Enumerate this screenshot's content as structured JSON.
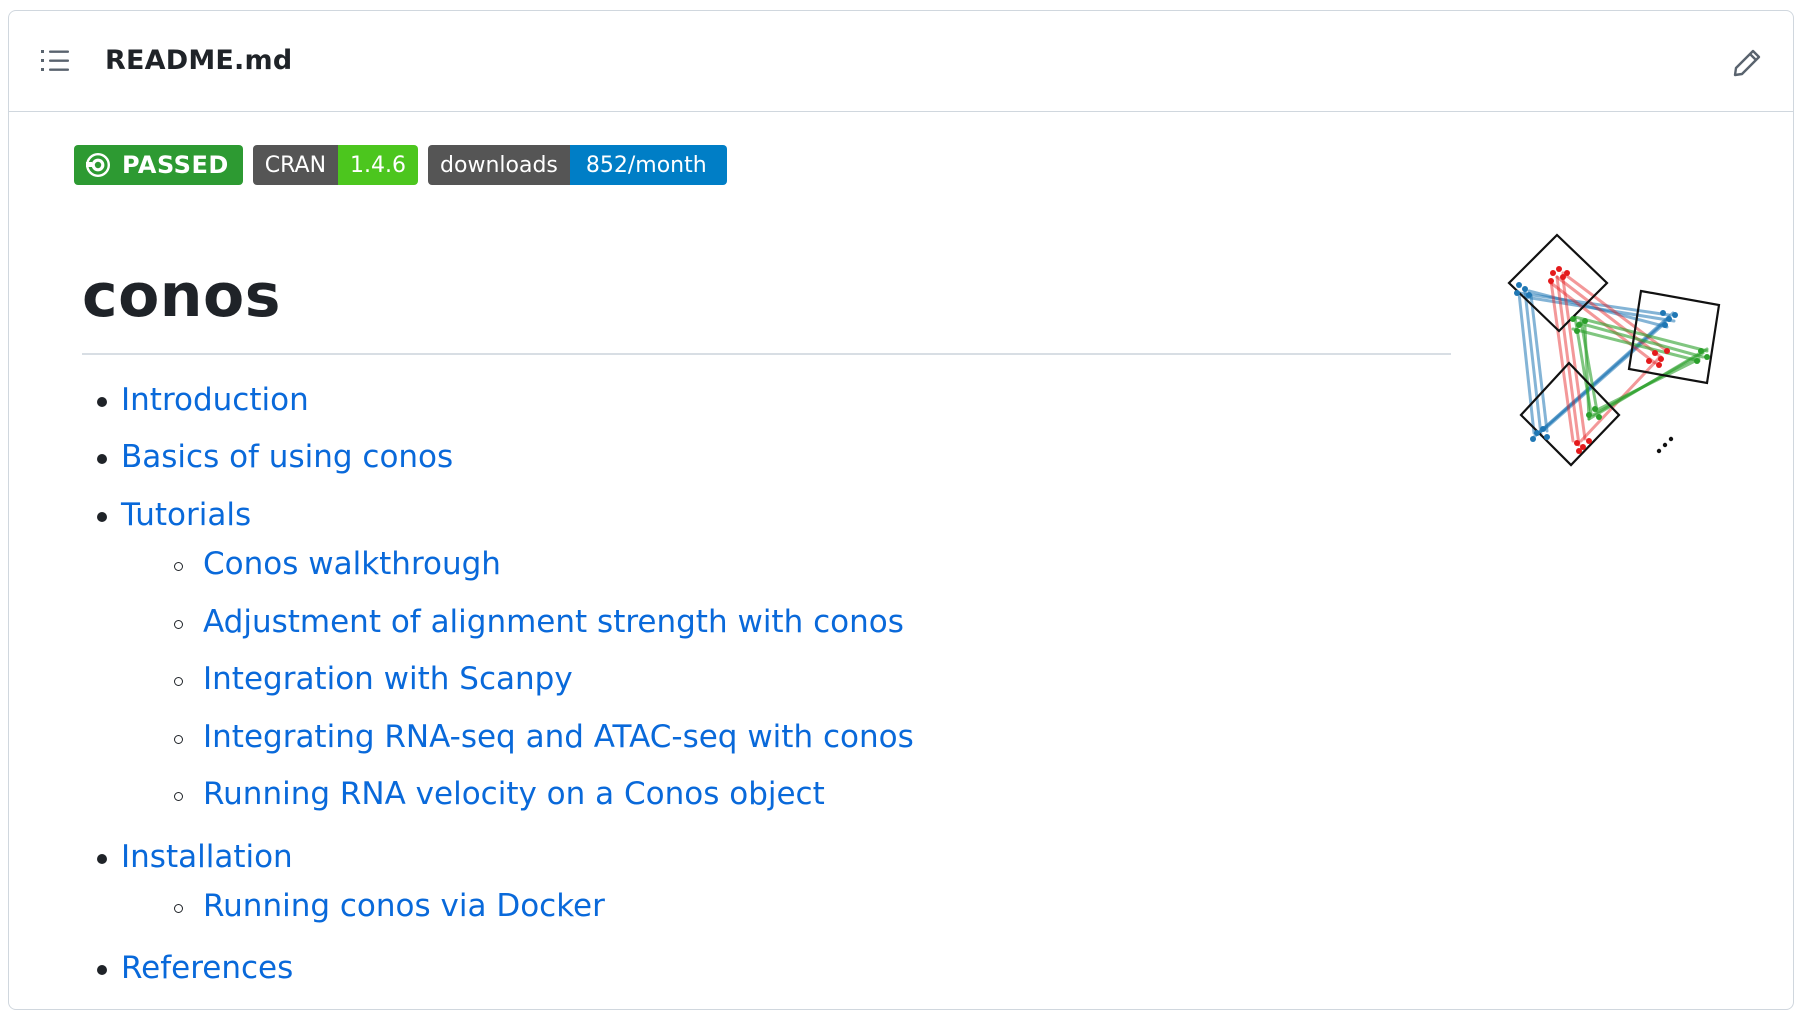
{
  "header": {
    "file_title": "README.md",
    "toc_icon": "list-unordered-icon",
    "edit_icon": "pencil-icon"
  },
  "badges": {
    "build": {
      "label": "PASSED",
      "icon": "circleci-icon",
      "color": "#2d9a32"
    },
    "cran": {
      "label": "CRAN",
      "value": "1.4.6",
      "value_color": "#4cc61e"
    },
    "downloads": {
      "label": "downloads",
      "value": "852/month",
      "value_color": "#007ec6"
    }
  },
  "readme": {
    "title": "conos",
    "toc": [
      {
        "label": "Introduction"
      },
      {
        "label": "Basics of using conos"
      },
      {
        "label": "Tutorials",
        "children": [
          {
            "label": "Conos walkthrough"
          },
          {
            "label": "Adjustment of alignment strength with conos"
          },
          {
            "label": "Integration with Scanpy"
          },
          {
            "label": "Integrating RNA-seq and ATAC-seq with conos"
          },
          {
            "label": "Running RNA velocity on a Conos object"
          }
        ]
      },
      {
        "label": "Installation",
        "children": [
          {
            "label": "Running conos via Docker"
          }
        ]
      },
      {
        "label": "References"
      }
    ]
  },
  "logo": {
    "name": "conos-logo",
    "colors": [
      "#1f77b4",
      "#e41a1c",
      "#2ca02c"
    ]
  },
  "colors": {
    "link": "#0969da",
    "text": "#1f2328",
    "border": "#d0d7de"
  }
}
